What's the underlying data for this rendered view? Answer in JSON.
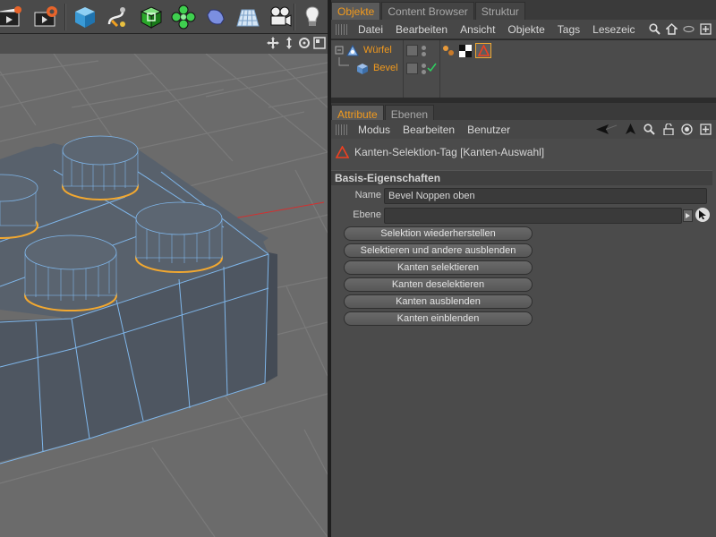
{
  "toolbar": {
    "icons": [
      "clapper-render-icon",
      "clapper-settings-icon",
      "cube-icon",
      "spline-pen-icon",
      "subdivision-cube-icon",
      "cloner-array-icon",
      "deformer-icon",
      "floor-plane-icon",
      "camera-icon",
      "light-bulb-icon"
    ]
  },
  "objects_panel": {
    "tabs": [
      "Objekte",
      "Content Browser",
      "Struktur"
    ],
    "menu": [
      "Datei",
      "Bearbeiten",
      "Ansicht",
      "Objekte",
      "Tags",
      "Lesezeic"
    ],
    "rows": [
      {
        "name": "Würfel"
      },
      {
        "name": "Bevel"
      }
    ]
  },
  "attributes_panel": {
    "tabs": [
      "Attribute",
      "Ebenen"
    ],
    "menu": [
      "Modus",
      "Bearbeiten",
      "Benutzer"
    ],
    "tag_title": "Kanten-Selektion-Tag [Kanten-Auswahl]",
    "group_title": "Basis-Eigenschaften",
    "fields": {
      "name_label": "Name",
      "name_value": "Bevel Noppen oben",
      "layer_label": "Ebene",
      "layer_value": ""
    },
    "buttons": [
      "Selektion wiederherstellen",
      "Selektieren und andere ausblenden",
      "Kanten selektieren",
      "Kanten deselektieren",
      "Kanten ausblenden",
      "Kanten einblenden"
    ]
  },
  "colors": {
    "accent": "#f29a1d",
    "selection_edge": "#f2a830",
    "wire": "#7fb6ea"
  }
}
